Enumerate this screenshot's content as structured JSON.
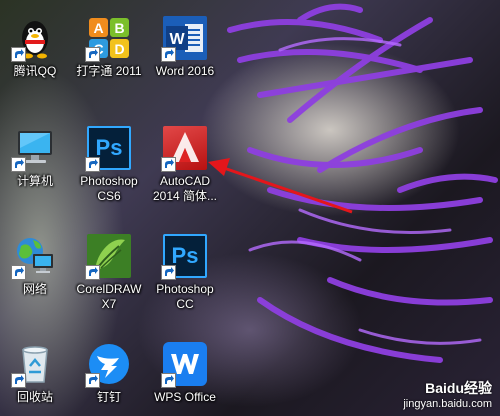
{
  "desktop": {
    "icons": [
      {
        "label": "腾讯QQ",
        "icon": "qq-penguin-icon"
      },
      {
        "label": "打字通 2011",
        "icon": "typing-abcd-icon"
      },
      {
        "label": "Word 2016",
        "icon": "word-icon"
      },
      {
        "label": "计算机",
        "icon": "computer-icon"
      },
      {
        "label": "Photoshop\nCS6",
        "icon": "photoshop-icon",
        "glyph": "Ps"
      },
      {
        "label": "AutoCAD\n2014 简体...",
        "icon": "autocad-icon"
      },
      {
        "label": "网络",
        "icon": "network-globe-icon"
      },
      {
        "label": "CorelDRAW\nX7",
        "icon": "coreldraw-icon"
      },
      {
        "label": "Photoshop\nCC",
        "icon": "photoshop-icon",
        "glyph": "Ps"
      },
      {
        "label": "回收站",
        "icon": "recycle-bin-icon"
      },
      {
        "label": "钉钉",
        "icon": "dingtalk-icon"
      },
      {
        "label": "WPS Office",
        "icon": "wps-icon"
      }
    ],
    "typing_letters": [
      "A",
      "B",
      "C",
      "D"
    ],
    "word_letter": "W"
  },
  "watermark": {
    "line1": "Baidu经验",
    "line2": "jingyan.baidu.com"
  },
  "colors": {
    "annotation_arrow": "#e4161b",
    "wallpaper_purple": "#8e3fe0"
  }
}
